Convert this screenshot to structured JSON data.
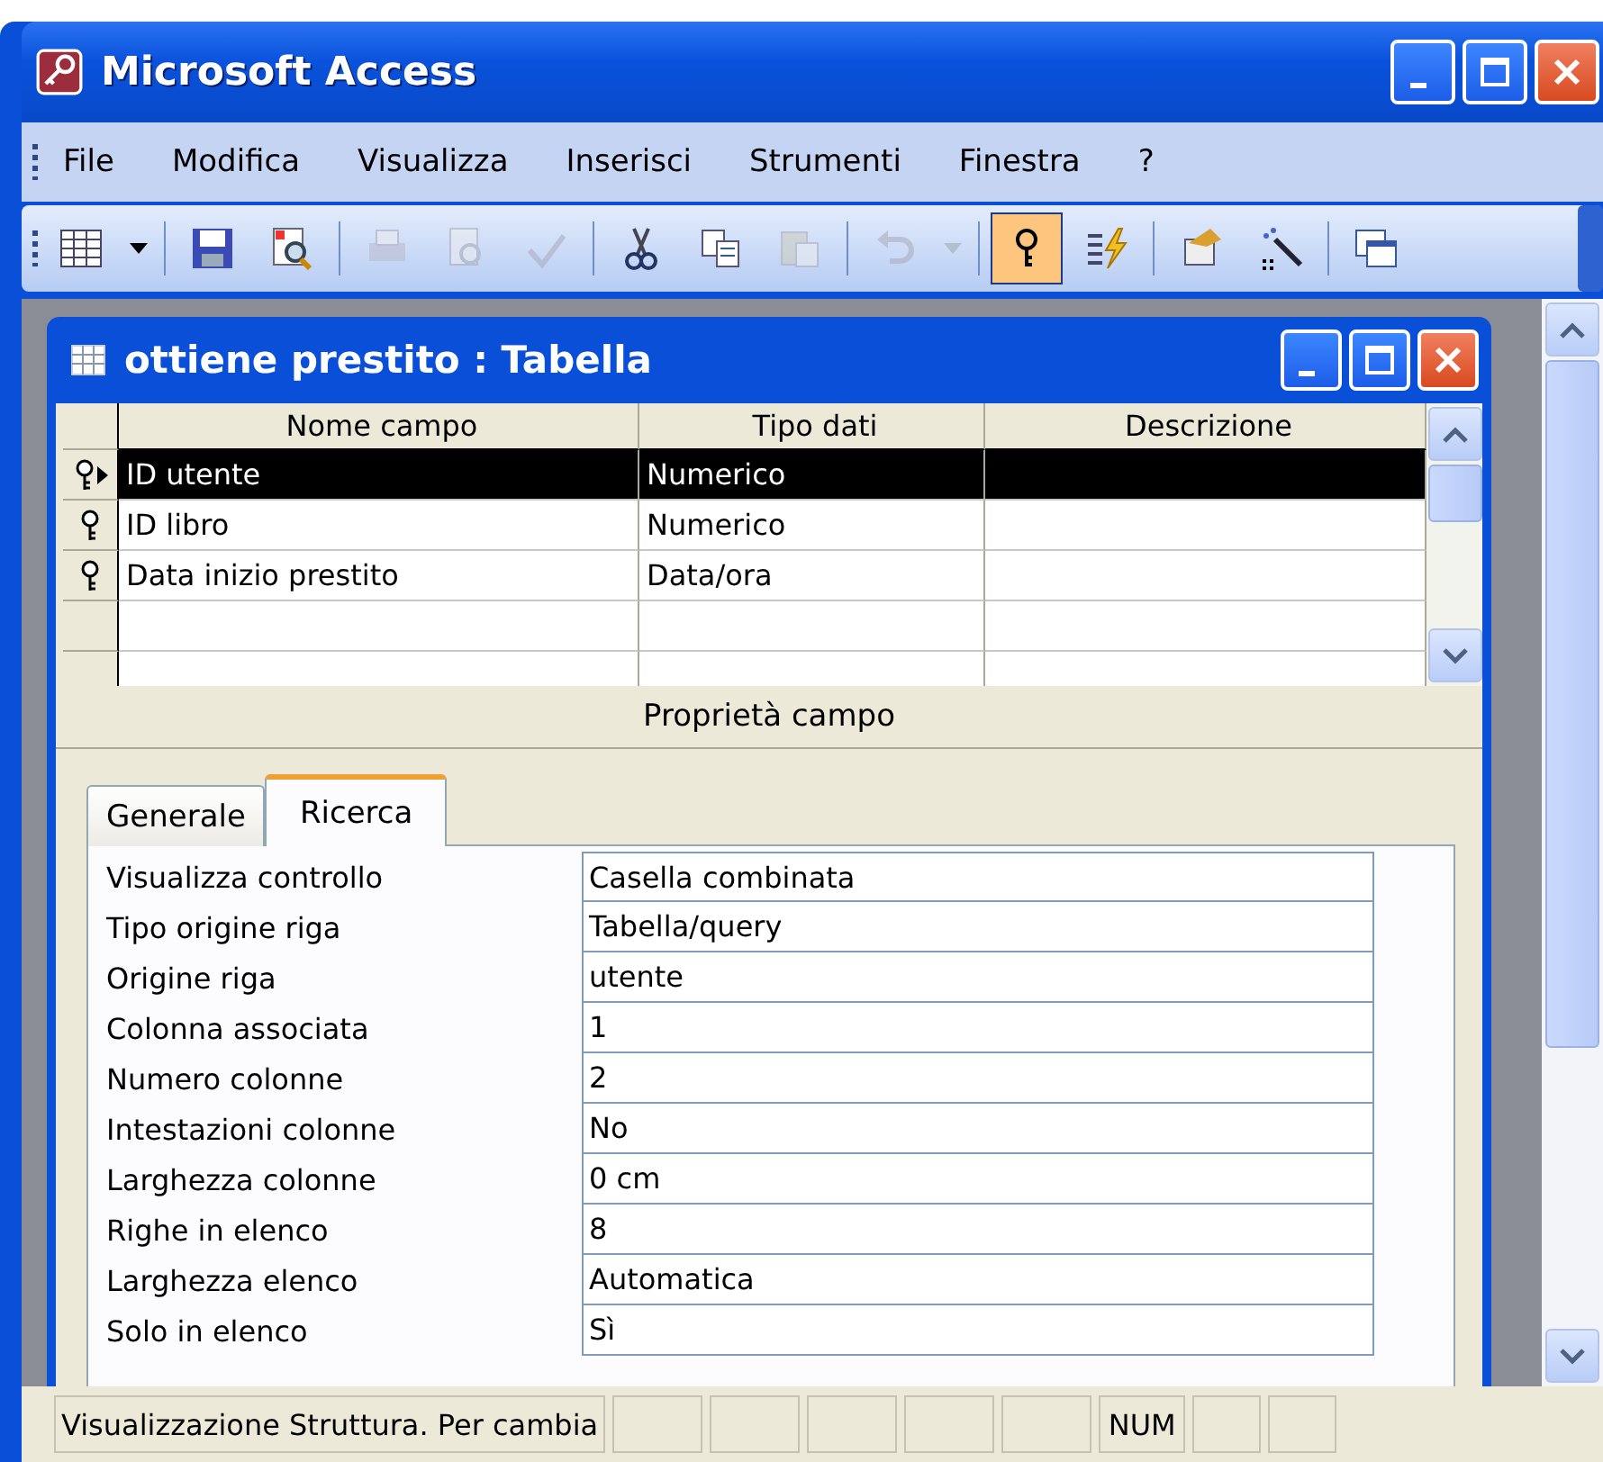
{
  "window": {
    "title": "Microsoft Access"
  },
  "menu": [
    {
      "label": "File"
    },
    {
      "label": "Modifica"
    },
    {
      "label": "Visualizza"
    },
    {
      "label": "Inserisci"
    },
    {
      "label": "Strumenti"
    },
    {
      "label": "Finestra"
    },
    {
      "label": "?"
    }
  ],
  "toolbar": [
    {
      "kind": "view",
      "disabled": false,
      "selected": false
    },
    {
      "kind": "dropdown",
      "disabled": false,
      "selected": false
    },
    {
      "kind": "separator"
    },
    {
      "kind": "save",
      "disabled": false,
      "selected": false
    },
    {
      "kind": "search",
      "disabled": false,
      "selected": false
    },
    {
      "kind": "separator"
    },
    {
      "kind": "print",
      "disabled": true,
      "selected": false
    },
    {
      "kind": "preview",
      "disabled": true,
      "selected": false
    },
    {
      "kind": "spelling",
      "disabled": true,
      "selected": false
    },
    {
      "kind": "separator"
    },
    {
      "kind": "cut",
      "disabled": false,
      "selected": false
    },
    {
      "kind": "copy",
      "disabled": false,
      "selected": false
    },
    {
      "kind": "paste",
      "disabled": true,
      "selected": false
    },
    {
      "kind": "separator"
    },
    {
      "kind": "undo",
      "disabled": true,
      "selected": false
    },
    {
      "kind": "dropdown",
      "disabled": true,
      "selected": false
    },
    {
      "kind": "separator"
    },
    {
      "kind": "key",
      "disabled": false,
      "selected": true
    },
    {
      "kind": "indexes",
      "disabled": false,
      "selected": false
    },
    {
      "kind": "separator"
    },
    {
      "kind": "properties",
      "disabled": false,
      "selected": false
    },
    {
      "kind": "build",
      "disabled": false,
      "selected": false
    },
    {
      "kind": "separator"
    },
    {
      "kind": "database",
      "disabled": false,
      "selected": false
    }
  ],
  "table_window": {
    "title": "ottiene prestito : Tabella",
    "columns": [
      "Nome campo",
      "Tipo dati",
      "Descrizione"
    ],
    "rows": [
      {
        "name": "ID utente",
        "type": "Numerico",
        "primary_key": true,
        "selected": true
      },
      {
        "name": "ID libro",
        "type": "Numerico",
        "primary_key": true,
        "selected": false
      },
      {
        "name": "Data inizio prestito",
        "type": "Data/ora",
        "primary_key": true,
        "selected": false
      }
    ],
    "section_label": "Proprietà campo",
    "tabs": [
      {
        "label": "Generale",
        "selected": false
      },
      {
        "label": "Ricerca",
        "selected": true
      }
    ],
    "properties": [
      {
        "label": "Visualizza controllo",
        "value": "Casella combinata"
      },
      {
        "label": "Tipo origine riga",
        "value": "Tabella/query"
      },
      {
        "label": "Origine riga",
        "value": "utente"
      },
      {
        "label": "Colonna associata",
        "value": "1"
      },
      {
        "label": "Numero colonne",
        "value": "2"
      },
      {
        "label": "Intestazioni colonne",
        "value": "No"
      },
      {
        "label": "Larghezza colonne",
        "value": "0 cm"
      },
      {
        "label": "Righe in elenco",
        "value": "8"
      },
      {
        "label": "Larghezza elenco",
        "value": "Automatica"
      },
      {
        "label": "Solo in elenco",
        "value": "Sì"
      }
    ]
  },
  "status_bar": {
    "text": "Visualizzazione Struttura. Per cambia",
    "indicator": "NUM"
  }
}
